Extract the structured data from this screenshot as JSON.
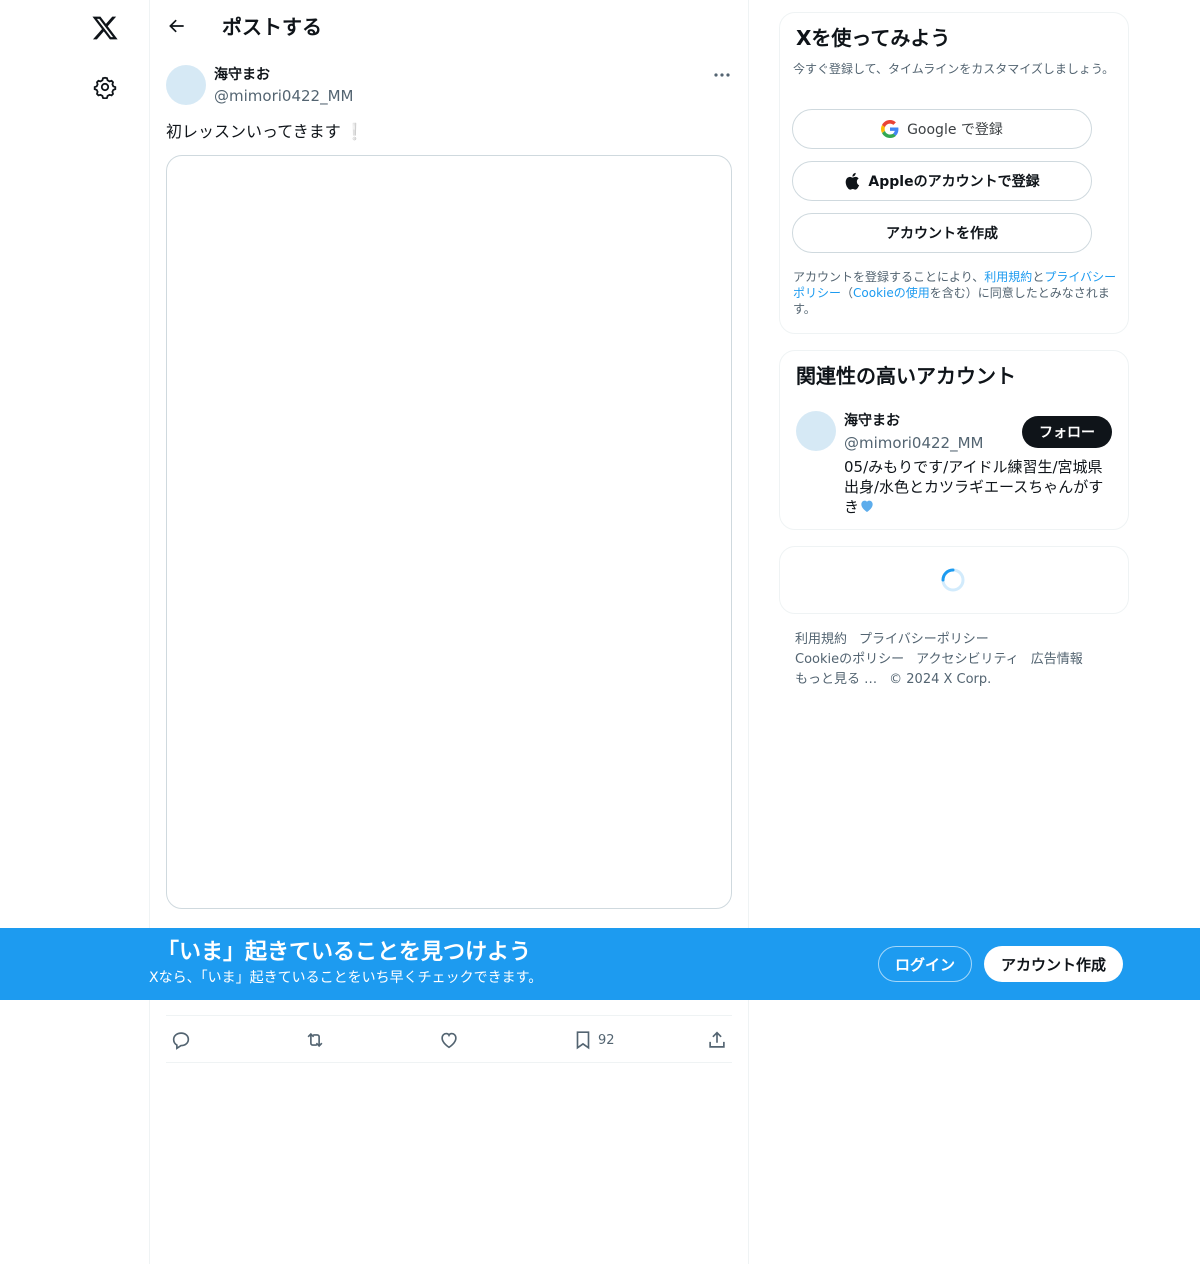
{
  "nav": {
    "logo_icon": "x-logo-icon",
    "settings_icon": "gear-icon"
  },
  "header": {
    "back_icon": "arrow-left-icon",
    "title": "ポストする"
  },
  "post": {
    "author_name": "海守まお",
    "author_handle": "@mimori0422_MM",
    "text": "初レッスンいってきます",
    "emoji": "❕",
    "more_icon": "more-dots-icon",
    "actions": {
      "reply_icon": "reply-icon",
      "repost_icon": "repost-icon",
      "like_icon": "heart-icon",
      "bookmark_icon": "bookmark-icon",
      "bookmark_count": "92",
      "share_icon": "share-icon"
    }
  },
  "signup": {
    "title": "Xを使ってみよう",
    "subtitle": "今すぐ登録して、タイムラインをカスタマイズしましょう。",
    "google_label": "Google で登録",
    "apple_label": "Appleのアカウントで登録",
    "create_label": "アカウントを作成",
    "terms_prefix": "アカウントを登録することにより、",
    "terms_link": "利用規約",
    "terms_and": "と",
    "privacy_link": "プライバシーポリシー",
    "terms_paren_open": "（",
    "cookie_link": "Cookieの使用",
    "terms_suffix": "を含む）に同意したとみなされます。"
  },
  "related": {
    "title": "関連性の高いアカウント",
    "name": "海守まお",
    "handle": "@mimori0422_MM",
    "follow_label": "フォロー",
    "bio": "05/みもりです/アイドル練習生/宮城県出身/水色とカツラギエースちゃんがすき"
  },
  "footer": {
    "links": [
      "利用規約",
      "プライバシーポリシー",
      "Cookieのポリシー",
      "アクセシビリティ",
      "広告情報",
      "もっと見る …"
    ],
    "copyright": "© 2024 X Corp."
  },
  "banner": {
    "title": "「いま」起きていることを見つけよう",
    "subtitle": "Xなら、「いま」起きていることをいち早くチェックできます。",
    "login_label": "ログイン",
    "signup_label": "アカウント作成"
  },
  "colors": {
    "accent": "#1d9bf0",
    "text": "#0f1419",
    "muted": "#536471",
    "border": "#eff3f4"
  }
}
